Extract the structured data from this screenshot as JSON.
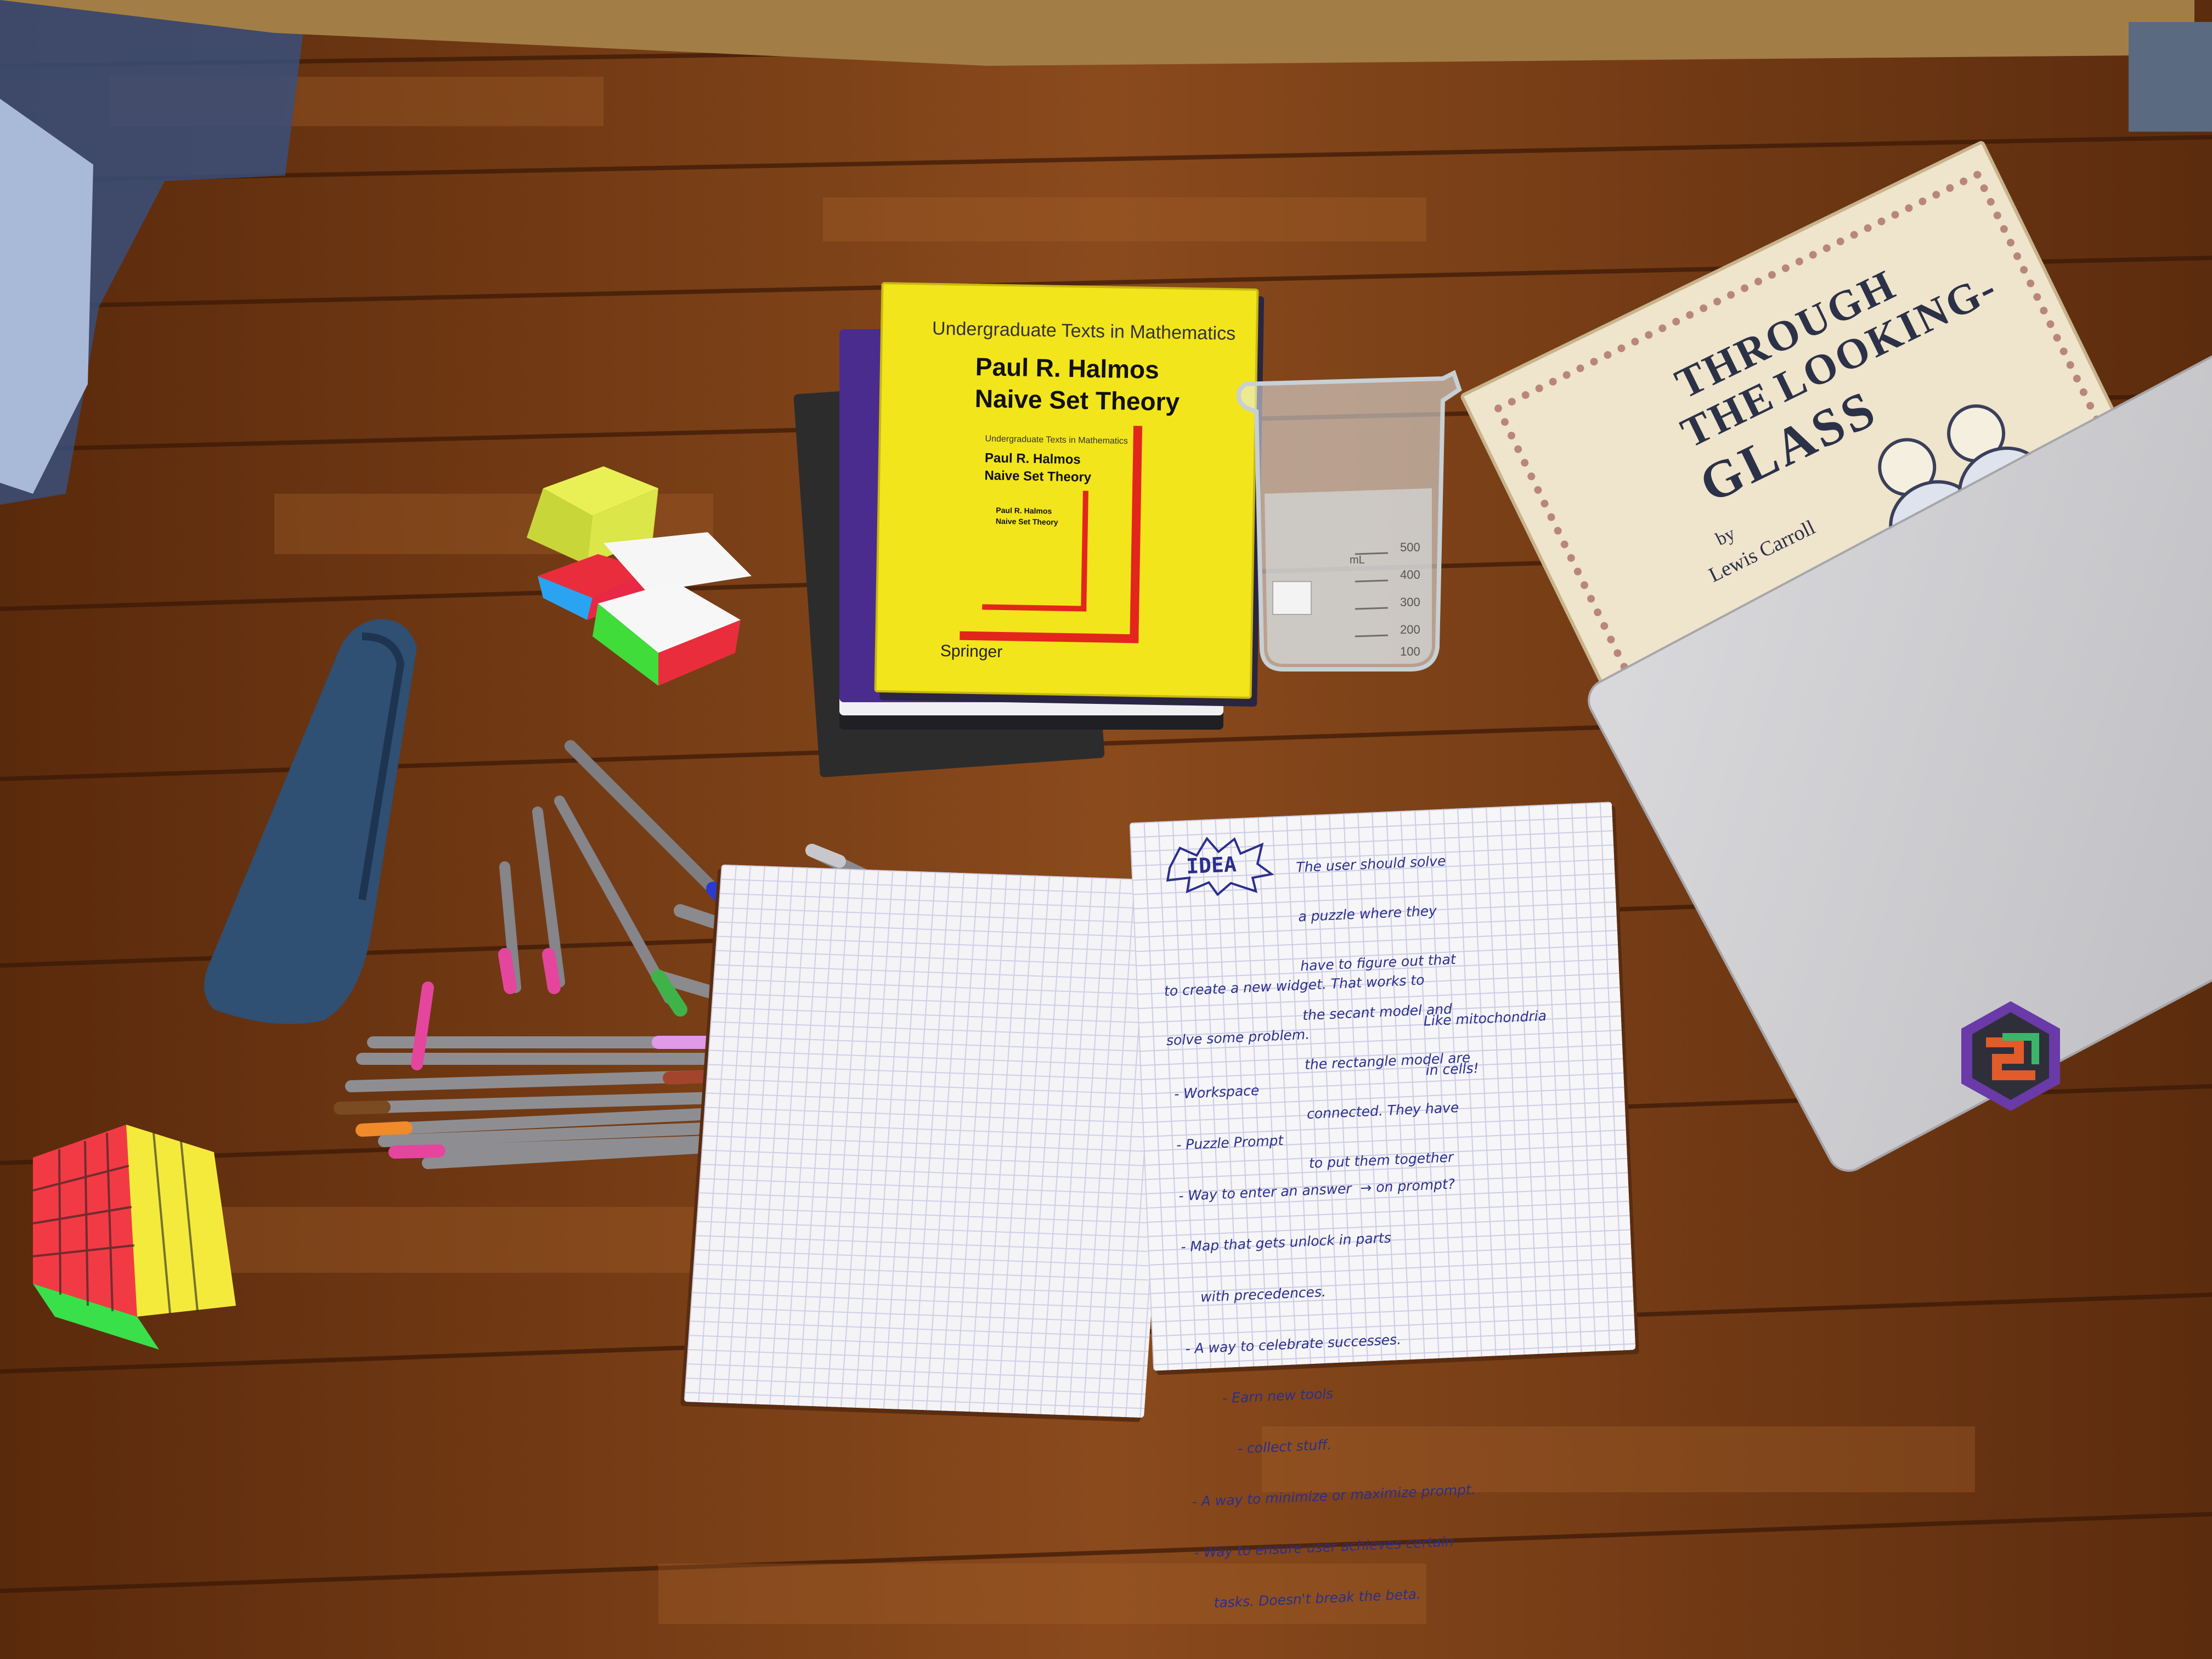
{
  "colors": {
    "floor": "#7a3e15",
    "book_yellow": "#f3e51c",
    "book_red_accent": "#e2261b",
    "ink": "#2a2f8c",
    "pencil_case": "#2f4f73",
    "laptop": "#c9c9cc",
    "sticker": "#6a3aa8"
  },
  "book_halmos": {
    "series": "Undergraduate Texts in Mathematics",
    "author": "Paul R. Halmos",
    "title": "Naive Set Theory",
    "publisher": "Springer"
  },
  "book_carroll": {
    "title_line1": "THROUGH",
    "title_line2": "THE",
    "title_line3": "LOOKING-",
    "title_line4": "GLASS",
    "by": "by",
    "author": "Lewis Carroll"
  },
  "beaker": {
    "top_label": "mL",
    "marks": [
      "500",
      "400",
      "300",
      "200",
      "100"
    ],
    "side_marks": [
      "400",
      "300",
      "200",
      "100"
    ]
  },
  "notebook": {
    "badge": "IDEA",
    "paragraph": [
      "The user should solve",
      "a puzzle where they",
      "have to figure out that",
      "the secant model and",
      "the rectangle model are",
      "connected. They have",
      "to put them together",
      "to create a new widget. That works to",
      "solve some problem."
    ],
    "aside": [
      "Like mitochondria",
      "in cells!"
    ],
    "list": [
      "- Workspace",
      "- Puzzle Prompt",
      "- Way to enter an answer  → on prompt?",
      "- Map that gets unlock in parts",
      "    with precedences.",
      "- A way to celebrate successes.",
      "        - Earn new tools",
      "           - collect stuff.",
      "- A way to minimize or maximize prompt.",
      "- Way to ensure user achieves certain",
      "    tasks. Doesn't break the beta."
    ]
  },
  "icons": [
    "rubiks-cube-icon",
    "pen-icon",
    "hexagon-sticker-icon"
  ]
}
